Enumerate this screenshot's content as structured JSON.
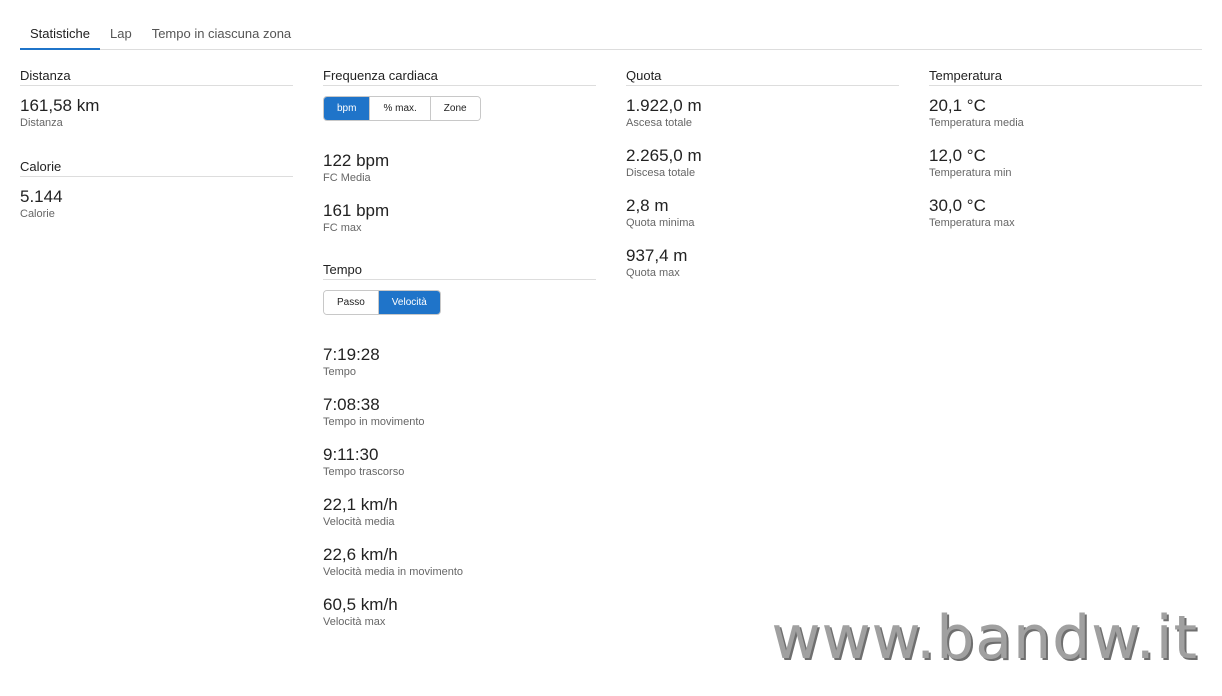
{
  "tabs": [
    {
      "label": "Statistiche",
      "active": true
    },
    {
      "label": "Lap",
      "active": false
    },
    {
      "label": "Tempo in ciascuna zona",
      "active": false
    }
  ],
  "distanza": {
    "title": "Distanza",
    "stats": [
      {
        "value": "161,58 km",
        "label": "Distanza"
      }
    ]
  },
  "calorie": {
    "title": "Calorie",
    "stats": [
      {
        "value": "5.144",
        "label": "Calorie"
      }
    ]
  },
  "frequenza": {
    "title": "Frequenza cardiaca",
    "toggle": [
      {
        "label": "bpm",
        "active": true
      },
      {
        "label": "% max.",
        "active": false
      },
      {
        "label": "Zone",
        "active": false
      }
    ],
    "stats": [
      {
        "value": "122 bpm",
        "label": "FC Media"
      },
      {
        "value": "161 bpm",
        "label": "FC max"
      }
    ]
  },
  "tempo": {
    "title": "Tempo",
    "toggle": [
      {
        "label": "Passo",
        "active": false
      },
      {
        "label": "Velocità",
        "active": true
      }
    ],
    "stats": [
      {
        "value": "7:19:28",
        "label": "Tempo"
      },
      {
        "value": "7:08:38",
        "label": "Tempo in movimento"
      },
      {
        "value": "9:11:30",
        "label": "Tempo trascorso"
      },
      {
        "value": "22,1 km/h",
        "label": "Velocità media"
      },
      {
        "value": "22,6 km/h",
        "label": "Velocità media in movimento"
      },
      {
        "value": "60,5 km/h",
        "label": "Velocità max"
      }
    ]
  },
  "quota": {
    "title": "Quota",
    "stats": [
      {
        "value": "1.922,0 m",
        "label": "Ascesa totale"
      },
      {
        "value": "2.265,0 m",
        "label": "Discesa totale"
      },
      {
        "value": "2,8 m",
        "label": "Quota minima"
      },
      {
        "value": "937,4 m",
        "label": "Quota max"
      }
    ]
  },
  "temperatura": {
    "title": "Temperatura",
    "stats": [
      {
        "value": "20,1 °C",
        "label": "Temperatura media"
      },
      {
        "value": "12,0 °C",
        "label": "Temperatura min"
      },
      {
        "value": "30,0 °C",
        "label": "Temperatura max"
      }
    ]
  },
  "watermark": "www.bandw.it",
  "colors": {
    "accent": "#1f74c9",
    "border": "#dddddd",
    "muted_text": "#666666"
  }
}
